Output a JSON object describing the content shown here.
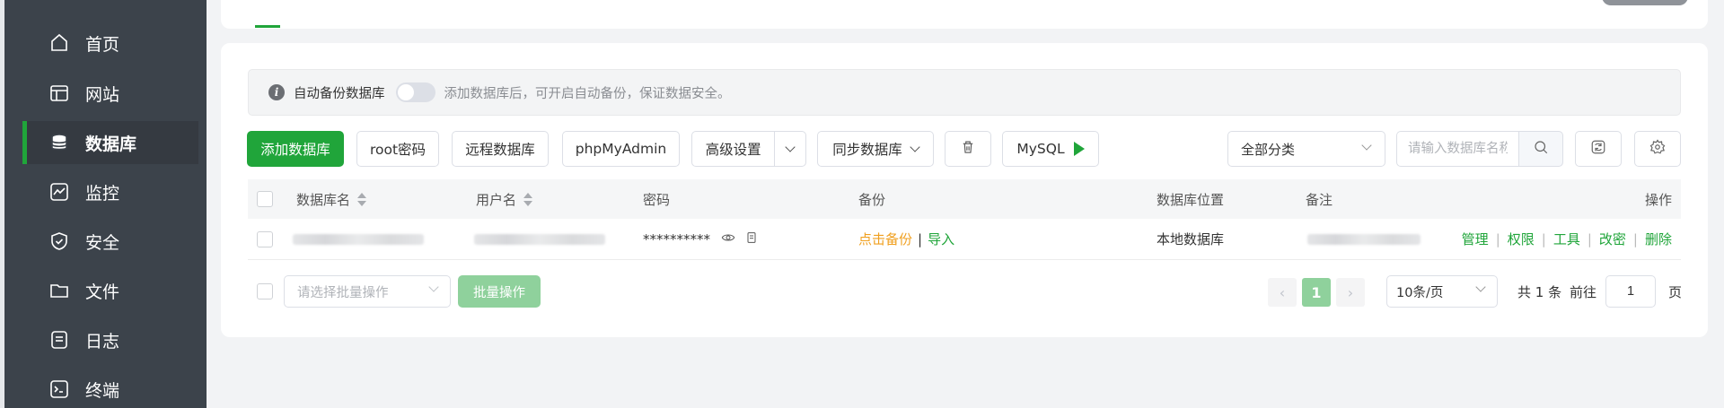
{
  "sidebar": {
    "items": [
      {
        "label": "首页",
        "icon": "home-icon"
      },
      {
        "label": "网站",
        "icon": "website-icon"
      },
      {
        "label": "数据库",
        "icon": "database-icon",
        "active": true
      },
      {
        "label": "监控",
        "icon": "monitor-icon"
      },
      {
        "label": "安全",
        "icon": "shield-icon"
      },
      {
        "label": "文件",
        "icon": "folder-icon"
      },
      {
        "label": "日志",
        "icon": "log-icon"
      },
      {
        "label": "终端",
        "icon": "terminal-icon"
      }
    ]
  },
  "notice": {
    "label": "自动备份数据库",
    "tip": "添加数据库后，可开启自动备份，保证数据安全。",
    "toggle_on": false
  },
  "toolbar": {
    "add_db": "添加数据库",
    "root_pwd": "root密码",
    "remote_db": "远程数据库",
    "phpmyadmin": "phpMyAdmin",
    "advanced": "高级设置",
    "sync": "同步数据库",
    "mysql": "MySQL",
    "category": "全部分类",
    "search_placeholder": "请输入数据库名称"
  },
  "table": {
    "headers": {
      "name": "数据库名",
      "user": "用户名",
      "password": "密码",
      "backup": "备份",
      "location": "数据库位置",
      "remark": "备注",
      "actions": "操作"
    },
    "rows": [
      {
        "password": "**********",
        "backup_link": "点击备份",
        "import_link": "导入",
        "location": "本地数据库",
        "actions": [
          "管理",
          "权限",
          "工具",
          "改密",
          "删除"
        ]
      }
    ]
  },
  "footer": {
    "batch_placeholder": "请选择批量操作",
    "batch_button": "批量操作",
    "page_current": "1",
    "prev": "‹",
    "next": "›",
    "page_size": "10条/页",
    "total": "共 1 条",
    "goto_prefix": "前往",
    "goto_value": "1",
    "goto_suffix": "页"
  },
  "colors": {
    "accent": "#20a53a",
    "sidebar_bg": "#3c434b",
    "link_orange": "#f0a020"
  }
}
